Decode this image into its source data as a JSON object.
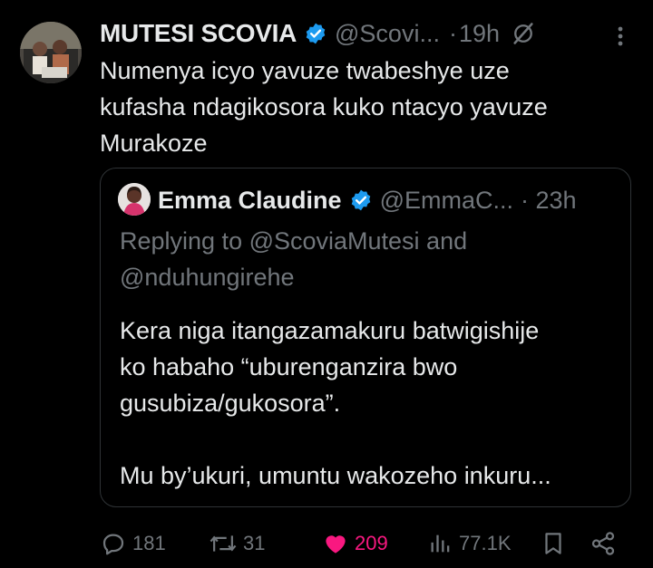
{
  "tweet": {
    "author_name": "MUTESI SCOVIA",
    "author_handle": "@Scovi...",
    "separator": "·",
    "time": "19h",
    "text_lines": [
      "Numenya icyo yavuze twabeshye uze",
      "kufasha ndagikosora kuko ntacyo yavuze",
      "Murakoze"
    ]
  },
  "quote": {
    "author_name": "Emma Claudine",
    "author_handle": "@EmmaC...",
    "time": "· 23h",
    "replying_lines": [
      "Replying to @ScoviaMutesi and",
      "@nduhungirehe"
    ],
    "text_lines": [
      "Kera niga itangazamakuru batwigishije",
      "ko habaho “uburenganzira bwo",
      "gusubiza/gukosora”.",
      "",
      "Mu by’ukuri, umuntu wakozeho inkuru..."
    ]
  },
  "actions": {
    "replies": "181",
    "reposts": "31",
    "likes": "209",
    "views": "77.1K"
  },
  "icons": {
    "verified": "verified-badge-icon",
    "grok": "grok-icon",
    "more": "more-icon",
    "reply": "reply-icon",
    "repost": "repost-icon",
    "like": "heart-icon",
    "views": "views-icon",
    "bookmark": "bookmark-icon",
    "share": "share-icon"
  },
  "colors": {
    "background": "#000000",
    "text": "#e7e9ea",
    "muted": "#71767b",
    "verified": "#1d9bf0",
    "like": "#f91880",
    "border": "#2f3336"
  }
}
